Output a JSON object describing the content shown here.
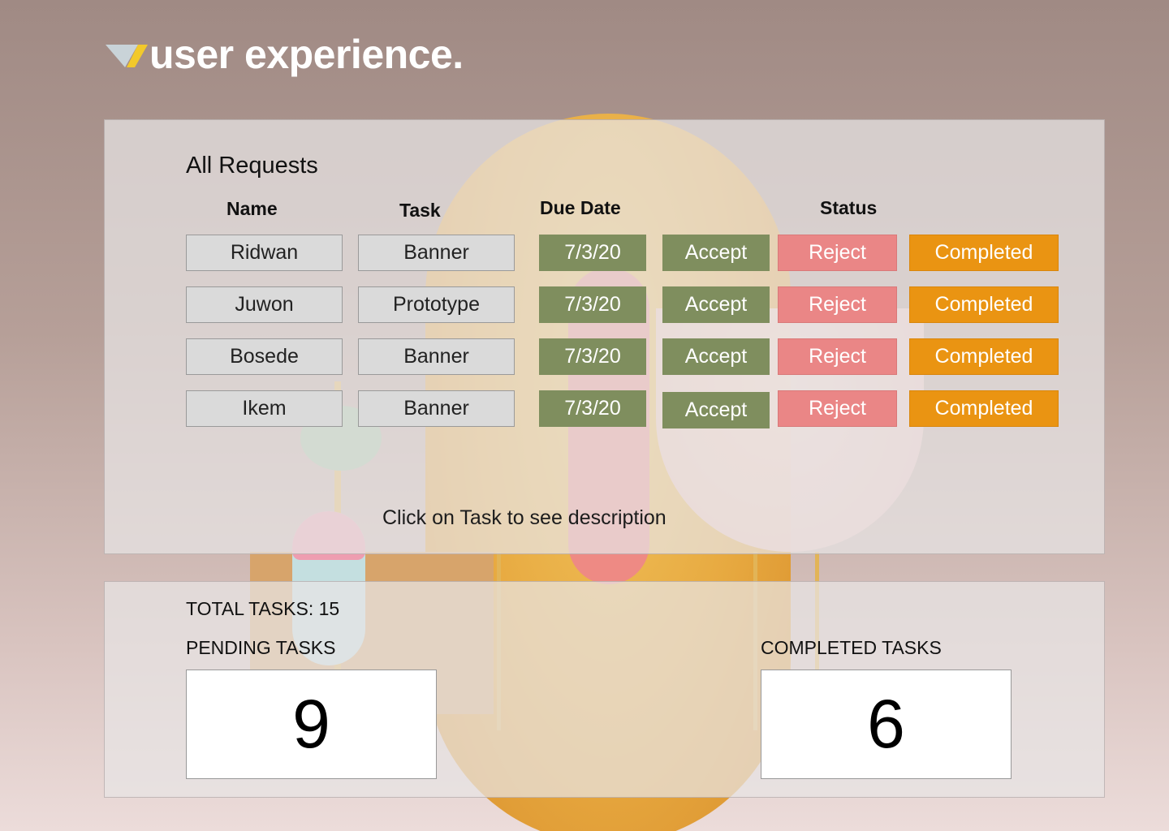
{
  "brand": {
    "name": "user experience."
  },
  "requests": {
    "title": "All Requests",
    "columns": {
      "name": "Name",
      "task": "Task",
      "due": "Due Date",
      "status": "Status"
    },
    "rows": [
      {
        "name": "Ridwan",
        "task": "Banner",
        "due": "7/3/20",
        "accept": "Accept",
        "reject": "Reject",
        "completed": "Completed"
      },
      {
        "name": "Juwon",
        "task": "Prototype",
        "due": "7/3/20",
        "accept": "Accept",
        "reject": "Reject",
        "completed": "Completed"
      },
      {
        "name": "Bosede",
        "task": "Banner",
        "due": "7/3/20",
        "accept": "Accept",
        "reject": "Reject",
        "completed": "Completed"
      },
      {
        "name": "Ikem",
        "task": "Banner",
        "due": "7/3/20",
        "accept": "Accept",
        "reject": "Reject",
        "completed": "Completed"
      }
    ],
    "hint": "Click on Task to see description"
  },
  "summary": {
    "total_label": "TOTAL TASKS: 15",
    "pending_label": "PENDING TASKS",
    "pending_value": "9",
    "completed_label": "COMPLETED TASKS",
    "completed_value": "6"
  },
  "colors": {
    "accept": "#7f8e5e",
    "reject": "#ea8686",
    "completed": "#ea9412",
    "logo_accent": "#f2c92b"
  }
}
